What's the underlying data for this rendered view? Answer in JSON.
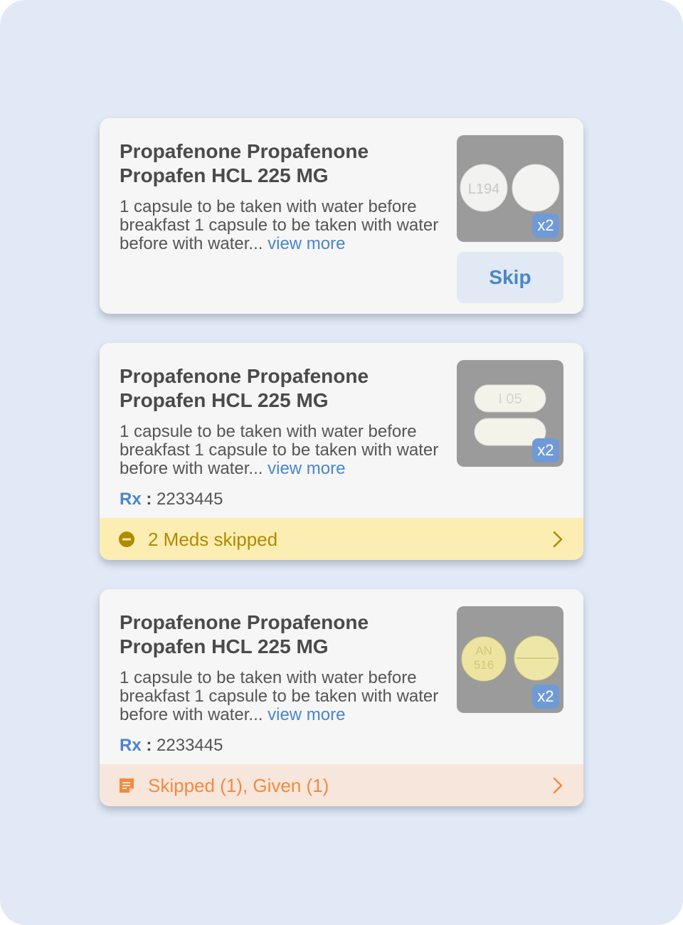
{
  "cards": [
    {
      "title_line1": "Propafenone Propafenone",
      "title_line2": "Propafen HCL 225 MG",
      "description": "1 capsule to be taken with water before breakfast 1 capsule to be taken with water before with water...",
      "view_more": "view more",
      "pill_imprint": "L194",
      "pill_count": "x2",
      "skip_label": "Skip"
    },
    {
      "title_line1": "Propafenone Propafenone",
      "title_line2": "Propafen HCL 225 MG",
      "description": "1 capsule to be taken with water before breakfast 1 capsule to be taken with water before with water...",
      "view_more": "view more",
      "pill_imprint": "I  05",
      "pill_count": "x2",
      "rx_label": "Rx",
      "rx_separator": ":",
      "rx_number": "2233445",
      "status_text": "2 Meds skipped"
    },
    {
      "title_line1": "Propafenone Propafenone",
      "title_line2": "Propafen HCL 225 MG",
      "description": "1 capsule to be taken with water before breakfast 1 capsule to be taken with water before with water...",
      "view_more": "view more",
      "pill_imprint_top": "AN",
      "pill_imprint_bottom": "516",
      "pill_count": "x2",
      "rx_label": "Rx",
      "rx_separator": ":",
      "rx_number": "2233445",
      "status_text": "Skipped (1), Given (1)"
    }
  ],
  "icons": {
    "skipped_status": "minus-circle-icon",
    "mixed_status": "note-icon",
    "arrow": "chevron-right-icon"
  },
  "colors": {
    "background": "#e0e9f5",
    "card": "#f6f6f6",
    "accent_blue": "#4a86c8",
    "badge_blue": "#6f9ad6",
    "skipped_bar": "#fcedb2",
    "skipped_text": "#b08a00",
    "mixed_bar": "#f7e6dc",
    "mixed_text": "#f08c3c"
  }
}
